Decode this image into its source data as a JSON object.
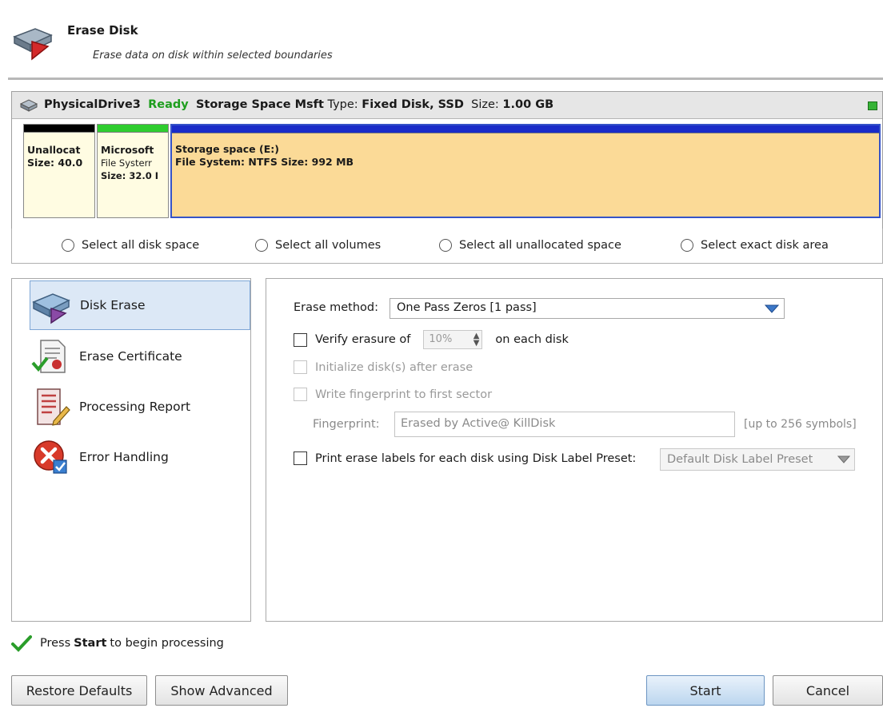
{
  "header": {
    "title": "Erase Disk",
    "subtitle": "Erase data on disk within selected boundaries"
  },
  "disk": {
    "name": "PhysicalDrive3",
    "status": "Ready",
    "model": "Storage Space Msft",
    "type_label": "Type:",
    "type_value": "Fixed Disk, SSD",
    "size_label": "Size:",
    "size_value": "1.00 GB",
    "partitions": [
      {
        "name": "Unallocat",
        "line2": "Size: 40.0",
        "line3": "",
        "bar_color": "#000000"
      },
      {
        "name": "Microsoft",
        "line2": "File Systerr",
        "line3": "Size: 32.0 I",
        "bar_color": "#2fcd2f"
      },
      {
        "name": "Storage space (E:)",
        "line2": "File System: NTFS Size: 992 MB",
        "line3": "",
        "bar_color": "#1a2cc8"
      }
    ]
  },
  "selection": {
    "options": [
      "Select all disk space",
      "Select all volumes",
      "Select all unallocated space",
      "Select exact disk area"
    ]
  },
  "nav": {
    "items": [
      {
        "label": "Disk Erase",
        "icon": "disk-erase-icon"
      },
      {
        "label": "Erase Certificate",
        "icon": "certificate-icon"
      },
      {
        "label": "Processing Report",
        "icon": "report-icon"
      },
      {
        "label": "Error Handling",
        "icon": "error-icon"
      }
    ]
  },
  "options": {
    "method_label": "Erase method:",
    "method_value": "One Pass Zeros [1 pass]",
    "verify_label": "Verify erasure of",
    "verify_value": "10%",
    "verify_suffix": "on each disk",
    "initialize_label": "Initialize disk(s) after erase",
    "fingerprint_write_label": "Write fingerprint to first sector",
    "fingerprint_label": "Fingerprint:",
    "fingerprint_value": "Erased by Active@ KillDisk",
    "fingerprint_hint": "[up to 256 symbols]",
    "print_labels_label": "Print erase labels for each disk using Disk Label Preset:",
    "label_preset_value": "Default Disk Label Preset"
  },
  "status": {
    "prefix": "Press",
    "bold": "Start",
    "suffix": "to begin processing"
  },
  "buttons": {
    "restore": "Restore Defaults",
    "advanced": "Show Advanced",
    "start": "Start",
    "cancel": "Cancel"
  },
  "colors": {
    "ready": "#1e9e1e",
    "selected_partition": "#fbda97",
    "selection_border": "#3553c8",
    "nav_selected": "#dce8f6"
  }
}
